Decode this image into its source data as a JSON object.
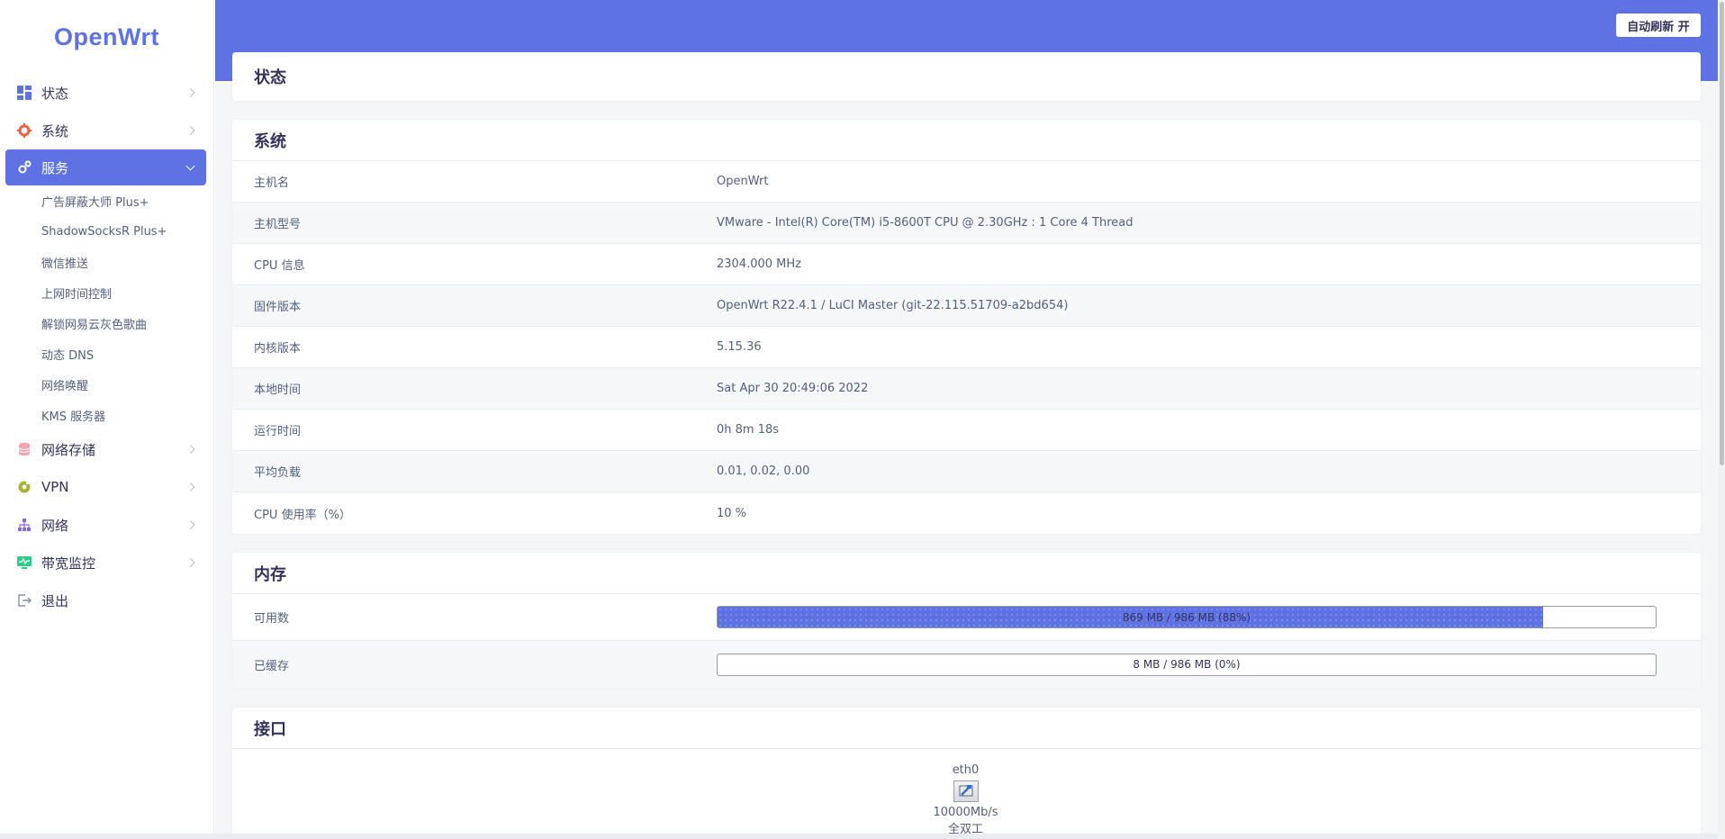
{
  "sidebar": {
    "logo": "OpenWrt",
    "items": [
      {
        "label": "状态",
        "icon": "dashboard-icon"
      },
      {
        "label": "系统",
        "icon": "gear-icon"
      },
      {
        "label": "服务",
        "icon": "services-icon"
      },
      {
        "label": "网络存储",
        "icon": "storage-icon"
      },
      {
        "label": "VPN",
        "icon": "vpn-icon"
      },
      {
        "label": "网络",
        "icon": "network-icon"
      },
      {
        "label": "带宽监控",
        "icon": "monitor-icon"
      },
      {
        "label": "退出",
        "icon": "logout-icon"
      }
    ],
    "sub_items": [
      "广告屏蔽大师 Plus+",
      "ShadowSocksR Plus+",
      "微信推送",
      "上网时间控制",
      "解锁网易云灰色歌曲",
      "动态 DNS",
      "网络唤醒",
      "KMS 服务器"
    ]
  },
  "header": {
    "refresh_label": "自动刷新 开",
    "page_title": "状态"
  },
  "system": {
    "title": "系统",
    "rows": [
      {
        "key": "主机名",
        "value": "OpenWrt"
      },
      {
        "key": "主机型号",
        "value": "VMware - Intel(R) Core(TM) i5-8600T CPU @ 2.30GHz : 1 Core 4 Thread"
      },
      {
        "key": "CPU 信息",
        "value": "2304.000 MHz"
      },
      {
        "key": "固件版本",
        "value": "OpenWrt R22.4.1 / LuCI Master (git-22.115.51709-a2bd654)"
      },
      {
        "key": "内核版本",
        "value": "5.15.36"
      },
      {
        "key": "本地时间",
        "value": "Sat Apr 30 20:49:06 2022"
      },
      {
        "key": "运行时间",
        "value": "0h 8m 18s"
      },
      {
        "key": "平均负载",
        "value": "0.01, 0.02, 0.00"
      },
      {
        "key": "CPU 使用率（%）",
        "value": "10 %"
      }
    ]
  },
  "memory": {
    "title": "内存",
    "rows": [
      {
        "key": "可用数",
        "bar_label": "869 MB / 986 MB (88%)",
        "percent": 88
      },
      {
        "key": "已缓存",
        "bar_label": "8 MB / 986 MB (0%)",
        "percent": 0
      }
    ]
  },
  "interfaces": {
    "title": "接口",
    "port_name": "eth0",
    "speed": "10000Mb/s",
    "duplex": "全双工"
  },
  "colors": {
    "accent": "#5e72e4"
  }
}
